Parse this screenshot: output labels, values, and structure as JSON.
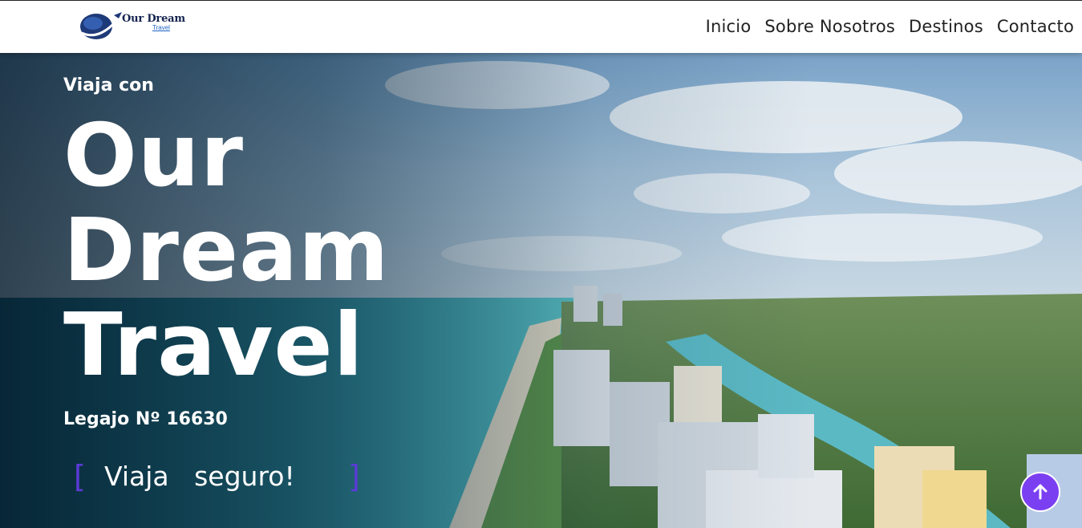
{
  "header": {
    "logo_text": "Our Dream",
    "logo_sub": "Travel",
    "nav": [
      {
        "label": "Inicio"
      },
      {
        "label": "Sobre Nosotros"
      },
      {
        "label": "Destinos"
      },
      {
        "label": "Contacto"
      }
    ]
  },
  "hero": {
    "pre_title": "Viaja con",
    "title_lines": [
      "Our",
      "Dream",
      "Travel"
    ],
    "legajo": "Legajo Nº 16630",
    "typed_left_bracket": "[",
    "typed_text": "Viaja   seguro!",
    "typed_right_bracket": "]"
  },
  "colors": {
    "accent": "#7b3ff2",
    "bracket": "#5b3bd6",
    "logo_navy": "#14234f"
  },
  "icons": {
    "back_to_top": "arrow-up-icon",
    "logo": "globe-plane-icon"
  }
}
